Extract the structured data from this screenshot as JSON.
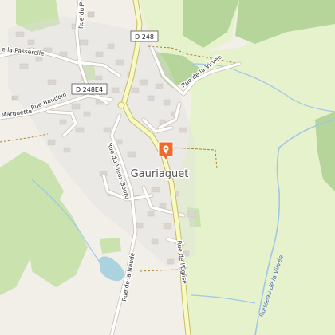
{
  "map": {
    "place": "Gauriaguet",
    "marker_icon": "map-pin-icon",
    "colors": {
      "background": "#f2efe9",
      "meadow": "#e6f2cc",
      "forest": "#b5d59a",
      "vineyard": "#c9e2ae",
      "water": "#aad3df",
      "stream": "#9fc7e6",
      "road_primary": "#f7fabf",
      "road_minor": "#ffffff",
      "building": "#d9d0c9",
      "marker": "#f06a2b"
    },
    "roads": {
      "d248": "D 248",
      "d248e4": "D 248E4",
      "rue_de_la_passerelle": "e la Passerelle",
      "rue_du_p": "Rue du P",
      "rue_de_la_virvee": "Rue de la Virvée",
      "rue_baudoin": "Rue Baudoin",
      "marquette": "Marquette",
      "rue_du_vieux_bourg": "Rue du Vieux Bourg",
      "rue_de_leglise": "Rue de l'Église",
      "rue_de_la_naude": "Rue de la Naude"
    },
    "water": {
      "stream_name": "Ruisseau de la Virvée"
    }
  }
}
